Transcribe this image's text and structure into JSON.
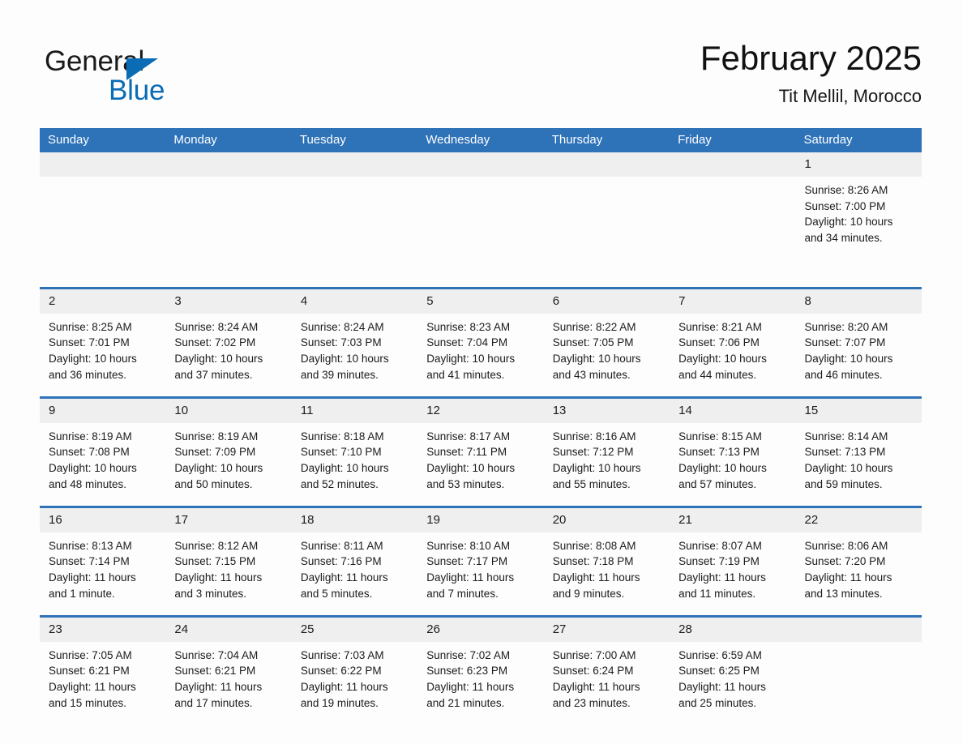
{
  "brand": {
    "name_part1": "General",
    "name_part2": "Blue",
    "logo_icon": "blue-triangle-logo",
    "accent_color": "#0a6cb5"
  },
  "header": {
    "title": "February 2025",
    "location": "Tit Mellil, Morocco",
    "header_bg_color": "#2e72b8",
    "daynum_bg_color": "#efefef"
  },
  "weekdays": [
    "Sunday",
    "Monday",
    "Tuesday",
    "Wednesday",
    "Thursday",
    "Friday",
    "Saturday"
  ],
  "labels": {
    "sunrise_prefix": "Sunrise:",
    "sunset_prefix": "Sunset:",
    "daylight_prefix": "Daylight:"
  },
  "weeks": [
    [
      {
        "day": "",
        "sunrise": "",
        "sunset": "",
        "daylight_line1": "",
        "daylight_line2": ""
      },
      {
        "day": "",
        "sunrise": "",
        "sunset": "",
        "daylight_line1": "",
        "daylight_line2": ""
      },
      {
        "day": "",
        "sunrise": "",
        "sunset": "",
        "daylight_line1": "",
        "daylight_line2": ""
      },
      {
        "day": "",
        "sunrise": "",
        "sunset": "",
        "daylight_line1": "",
        "daylight_line2": ""
      },
      {
        "day": "",
        "sunrise": "",
        "sunset": "",
        "daylight_line1": "",
        "daylight_line2": ""
      },
      {
        "day": "",
        "sunrise": "",
        "sunset": "",
        "daylight_line1": "",
        "daylight_line2": ""
      },
      {
        "day": "1",
        "sunrise": "Sunrise: 8:26 AM",
        "sunset": "Sunset: 7:00 PM",
        "daylight_line1": "Daylight: 10 hours",
        "daylight_line2": "and 34 minutes."
      }
    ],
    [
      {
        "day": "2",
        "sunrise": "Sunrise: 8:25 AM",
        "sunset": "Sunset: 7:01 PM",
        "daylight_line1": "Daylight: 10 hours",
        "daylight_line2": "and 36 minutes."
      },
      {
        "day": "3",
        "sunrise": "Sunrise: 8:24 AM",
        "sunset": "Sunset: 7:02 PM",
        "daylight_line1": "Daylight: 10 hours",
        "daylight_line2": "and 37 minutes."
      },
      {
        "day": "4",
        "sunrise": "Sunrise: 8:24 AM",
        "sunset": "Sunset: 7:03 PM",
        "daylight_line1": "Daylight: 10 hours",
        "daylight_line2": "and 39 minutes."
      },
      {
        "day": "5",
        "sunrise": "Sunrise: 8:23 AM",
        "sunset": "Sunset: 7:04 PM",
        "daylight_line1": "Daylight: 10 hours",
        "daylight_line2": "and 41 minutes."
      },
      {
        "day": "6",
        "sunrise": "Sunrise: 8:22 AM",
        "sunset": "Sunset: 7:05 PM",
        "daylight_line1": "Daylight: 10 hours",
        "daylight_line2": "and 43 minutes."
      },
      {
        "day": "7",
        "sunrise": "Sunrise: 8:21 AM",
        "sunset": "Sunset: 7:06 PM",
        "daylight_line1": "Daylight: 10 hours",
        "daylight_line2": "and 44 minutes."
      },
      {
        "day": "8",
        "sunrise": "Sunrise: 8:20 AM",
        "sunset": "Sunset: 7:07 PM",
        "daylight_line1": "Daylight: 10 hours",
        "daylight_line2": "and 46 minutes."
      }
    ],
    [
      {
        "day": "9",
        "sunrise": "Sunrise: 8:19 AM",
        "sunset": "Sunset: 7:08 PM",
        "daylight_line1": "Daylight: 10 hours",
        "daylight_line2": "and 48 minutes."
      },
      {
        "day": "10",
        "sunrise": "Sunrise: 8:19 AM",
        "sunset": "Sunset: 7:09 PM",
        "daylight_line1": "Daylight: 10 hours",
        "daylight_line2": "and 50 minutes."
      },
      {
        "day": "11",
        "sunrise": "Sunrise: 8:18 AM",
        "sunset": "Sunset: 7:10 PM",
        "daylight_line1": "Daylight: 10 hours",
        "daylight_line2": "and 52 minutes."
      },
      {
        "day": "12",
        "sunrise": "Sunrise: 8:17 AM",
        "sunset": "Sunset: 7:11 PM",
        "daylight_line1": "Daylight: 10 hours",
        "daylight_line2": "and 53 minutes."
      },
      {
        "day": "13",
        "sunrise": "Sunrise: 8:16 AM",
        "sunset": "Sunset: 7:12 PM",
        "daylight_line1": "Daylight: 10 hours",
        "daylight_line2": "and 55 minutes."
      },
      {
        "day": "14",
        "sunrise": "Sunrise: 8:15 AM",
        "sunset": "Sunset: 7:13 PM",
        "daylight_line1": "Daylight: 10 hours",
        "daylight_line2": "and 57 minutes."
      },
      {
        "day": "15",
        "sunrise": "Sunrise: 8:14 AM",
        "sunset": "Sunset: 7:13 PM",
        "daylight_line1": "Daylight: 10 hours",
        "daylight_line2": "and 59 minutes."
      }
    ],
    [
      {
        "day": "16",
        "sunrise": "Sunrise: 8:13 AM",
        "sunset": "Sunset: 7:14 PM",
        "daylight_line1": "Daylight: 11 hours",
        "daylight_line2": "and 1 minute."
      },
      {
        "day": "17",
        "sunrise": "Sunrise: 8:12 AM",
        "sunset": "Sunset: 7:15 PM",
        "daylight_line1": "Daylight: 11 hours",
        "daylight_line2": "and 3 minutes."
      },
      {
        "day": "18",
        "sunrise": "Sunrise: 8:11 AM",
        "sunset": "Sunset: 7:16 PM",
        "daylight_line1": "Daylight: 11 hours",
        "daylight_line2": "and 5 minutes."
      },
      {
        "day": "19",
        "sunrise": "Sunrise: 8:10 AM",
        "sunset": "Sunset: 7:17 PM",
        "daylight_line1": "Daylight: 11 hours",
        "daylight_line2": "and 7 minutes."
      },
      {
        "day": "20",
        "sunrise": "Sunrise: 8:08 AM",
        "sunset": "Sunset: 7:18 PM",
        "daylight_line1": "Daylight: 11 hours",
        "daylight_line2": "and 9 minutes."
      },
      {
        "day": "21",
        "sunrise": "Sunrise: 8:07 AM",
        "sunset": "Sunset: 7:19 PM",
        "daylight_line1": "Daylight: 11 hours",
        "daylight_line2": "and 11 minutes."
      },
      {
        "day": "22",
        "sunrise": "Sunrise: 8:06 AM",
        "sunset": "Sunset: 7:20 PM",
        "daylight_line1": "Daylight: 11 hours",
        "daylight_line2": "and 13 minutes."
      }
    ],
    [
      {
        "day": "23",
        "sunrise": "Sunrise: 7:05 AM",
        "sunset": "Sunset: 6:21 PM",
        "daylight_line1": "Daylight: 11 hours",
        "daylight_line2": "and 15 minutes."
      },
      {
        "day": "24",
        "sunrise": "Sunrise: 7:04 AM",
        "sunset": "Sunset: 6:21 PM",
        "daylight_line1": "Daylight: 11 hours",
        "daylight_line2": "and 17 minutes."
      },
      {
        "day": "25",
        "sunrise": "Sunrise: 7:03 AM",
        "sunset": "Sunset: 6:22 PM",
        "daylight_line1": "Daylight: 11 hours",
        "daylight_line2": "and 19 minutes."
      },
      {
        "day": "26",
        "sunrise": "Sunrise: 7:02 AM",
        "sunset": "Sunset: 6:23 PM",
        "daylight_line1": "Daylight: 11 hours",
        "daylight_line2": "and 21 minutes."
      },
      {
        "day": "27",
        "sunrise": "Sunrise: 7:00 AM",
        "sunset": "Sunset: 6:24 PM",
        "daylight_line1": "Daylight: 11 hours",
        "daylight_line2": "and 23 minutes."
      },
      {
        "day": "28",
        "sunrise": "Sunrise: 6:59 AM",
        "sunset": "Sunset: 6:25 PM",
        "daylight_line1": "Daylight: 11 hours",
        "daylight_line2": "and 25 minutes."
      },
      {
        "day": "",
        "sunrise": "",
        "sunset": "",
        "daylight_line1": "",
        "daylight_line2": ""
      }
    ]
  ]
}
